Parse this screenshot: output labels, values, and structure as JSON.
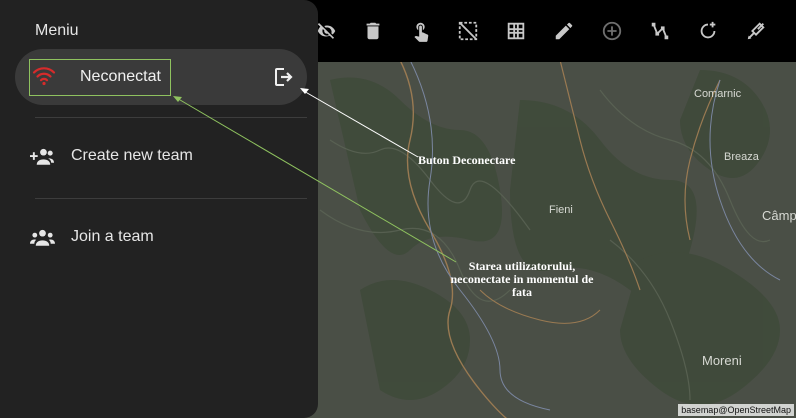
{
  "menu": {
    "title": "Meniu",
    "status": {
      "label": "Neconectat",
      "icon": "wifi-icon",
      "color": "#d62b2b",
      "logout_icon": "logout-icon"
    },
    "items": [
      {
        "label": "Create new team",
        "icon": "group-add-icon"
      },
      {
        "label": "Join a team",
        "icon": "group-icon"
      }
    ]
  },
  "toolbar": {
    "buttons": [
      "visibility-off-icon",
      "delete-icon",
      "touch-icon",
      "select-area-icon",
      "grid-icon",
      "edit-icon",
      "add-circle-icon",
      "polyline-icon",
      "rotate-add-icon",
      "eraser-icon"
    ]
  },
  "map": {
    "places": [
      "Comarnic",
      "Breaza",
      "Câmp",
      "Fieni",
      "Moreni"
    ],
    "attribution": "basemap@OpenStreetMap"
  },
  "annotations": {
    "logout_note": "Buton Deconectare",
    "status_note": "Starea utilizatorului, neconectate in momentul de fata"
  },
  "colors": {
    "drawer_bg": "#222222",
    "status_row_bg": "#3a3a3a",
    "highlight_border": "#8fc25f",
    "disconnected_red": "#d62b2b",
    "map_bg": "#4a4f46"
  }
}
